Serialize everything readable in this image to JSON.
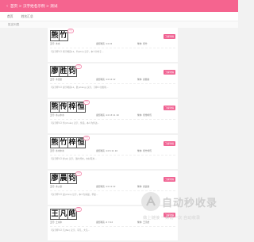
{
  "topbar": {
    "back_icon": "back-arrow-icon",
    "title": "首页 > 汉字姓名示例 > 测试"
  },
  "subnav": {
    "items": [
      "首页",
      "姓名汇总"
    ]
  },
  "breadcrumb": "姓名列表",
  "detail_label": "了解详情",
  "watermark": {
    "title": "自动秒收录",
    "subtitle": "做上链接 一来访一次 自动收录"
  },
  "cards": [
    {
      "chars": [
        "熊",
        "竹"
      ],
      "badge": "3分",
      "meta": {
        "c1": "五行: 木水",
        "c2": "康熙笔画: 14 22",
        "c3": "繁体: 熊竹"
      },
      "desc": "【汉字释义】熊字笔画14，竹(zhú) 汉字，本义为竹子..."
    },
    {
      "chars": [
        "廖",
        "胜",
        "钧"
      ],
      "badge": "3分",
      "meta": {
        "c1": "五行: 木金金",
        "c2": "康熙笔画: 14 12 12",
        "c3": "繁体: 廖勝鈞"
      },
      "desc": "【汉字释义】廖字笔画14，胜(shèng) 汉字，引申义为胜利..."
    },
    {
      "chars": [
        "熊",
        "传",
        "梓",
        "恒"
      ],
      "badge": "3分",
      "meta": {
        "c1": "五行: 水火木水",
        "c2": "康熙笔画: 14 13 11 10",
        "c3": "繁体: 熊傳梓恆"
      },
      "desc": "【汉字释义】传(chuán) 汉字，传递，本义为传达..."
    },
    {
      "chars": [
        "熊",
        "竹",
        "梓",
        "恒"
      ],
      "badge": "3分",
      "meta": {
        "c1": "五行: 水木木水",
        "c2": "康熙笔画: 14 6 11 10",
        "c3": "繁体: 熊竹梓恆"
      },
      "desc": "【汉字释义】梓(zǐ) 汉字，落叶乔木，木材可用..."
    },
    {
      "chars": [
        "廖",
        "晨",
        "钧"
      ],
      "badge": "3分",
      "meta": {
        "c1": "五行: 木火金",
        "c2": "康熙笔画: 14 11 12",
        "c3": "繁体: 廖晨鈞"
      },
      "desc": "【汉字释义】晨(chén) 汉字，本义为清晨，早晨..."
    },
    {
      "chars": [
        "王",
        "凡",
        "皓"
      ],
      "badge": "3分",
      "meta": {
        "c1": "五行: 土水木",
        "c2": "康熙笔画: 4 3 12",
        "c3": "繁体: 王凡皓"
      },
      "desc": "【汉字释义】凡(fán) 汉字，平凡，大凡..."
    }
  ]
}
